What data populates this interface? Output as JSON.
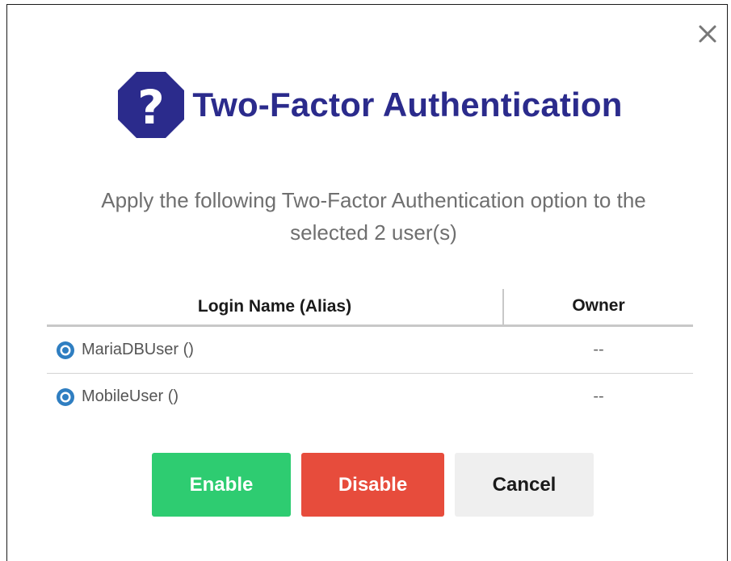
{
  "dialog": {
    "title": "Two-Factor Authentication",
    "title_icon": "question-octagon-icon",
    "close_icon": "close-icon",
    "message_line1": "Apply the following Two-Factor Authentication option to the",
    "message_line2": "selected 2 user(s)",
    "colors": {
      "title": "#2b2b8c",
      "icon_fill": "#2b2b8c",
      "enable": "#2ecc71",
      "disable": "#e74c3c",
      "cancel": "#efefef",
      "radio": "#2f7ec1"
    }
  },
  "table": {
    "headers": {
      "login": "Login Name (Alias)",
      "owner": "Owner"
    },
    "rows": [
      {
        "login": "MariaDBUser ()",
        "owner": "--",
        "icon": "radio-selected-icon"
      },
      {
        "login": "MobileUser ()",
        "owner": "--",
        "icon": "radio-selected-icon"
      }
    ]
  },
  "buttons": {
    "enable": "Enable",
    "disable": "Disable",
    "cancel": "Cancel"
  }
}
